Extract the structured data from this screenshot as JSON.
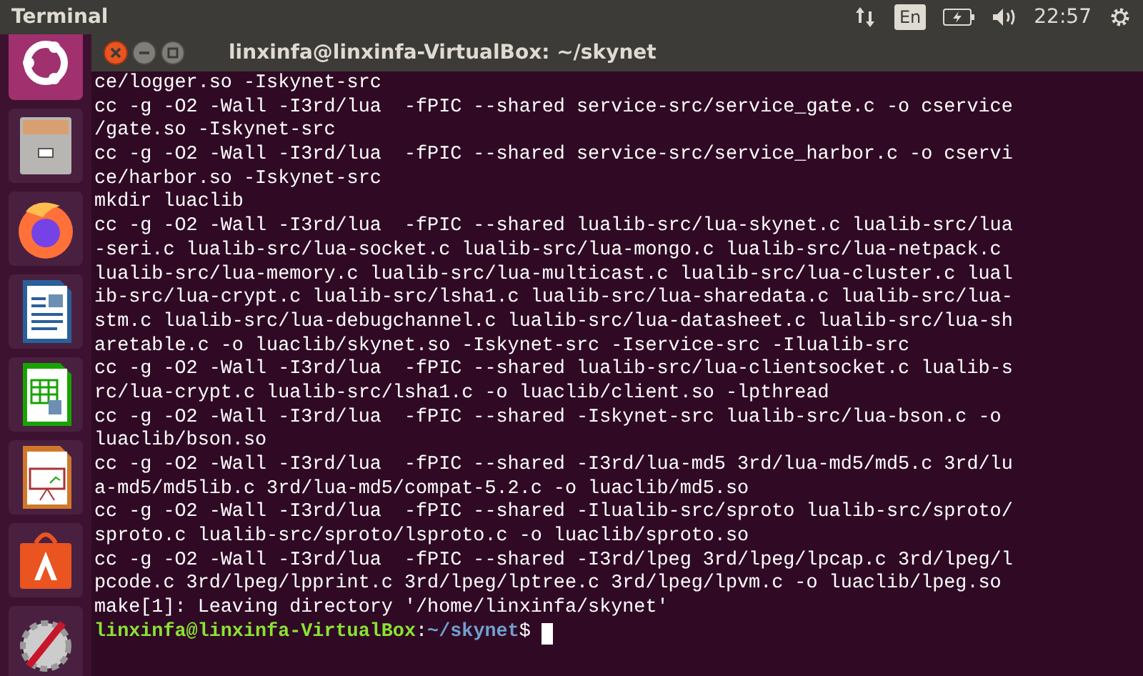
{
  "top_panel": {
    "app_title": "Terminal",
    "keyboard_layout": "En",
    "clock": "22:57"
  },
  "terminal": {
    "title": "linxinfa@linxinfa-VirtualBox: ~/skynet",
    "lines": [
      "ce/logger.so -Iskynet-src",
      "cc -g -O2 -Wall -I3rd/lua  -fPIC --shared service-src/service_gate.c -o cservice",
      "/gate.so -Iskynet-src",
      "cc -g -O2 -Wall -I3rd/lua  -fPIC --shared service-src/service_harbor.c -o cservi",
      "ce/harbor.so -Iskynet-src",
      "mkdir luaclib",
      "cc -g -O2 -Wall -I3rd/lua  -fPIC --shared lualib-src/lua-skynet.c lualib-src/lua",
      "-seri.c lualib-src/lua-socket.c lualib-src/lua-mongo.c lualib-src/lua-netpack.c",
      "lualib-src/lua-memory.c lualib-src/lua-multicast.c lualib-src/lua-cluster.c lual",
      "ib-src/lua-crypt.c lualib-src/lsha1.c lualib-src/lua-sharedata.c lualib-src/lua-",
      "stm.c lualib-src/lua-debugchannel.c lualib-src/lua-datasheet.c lualib-src/lua-sh",
      "aretable.c -o luaclib/skynet.so -Iskynet-src -Iservice-src -Ilualib-src",
      "cc -g -O2 -Wall -I3rd/lua  -fPIC --shared lualib-src/lua-clientsocket.c lualib-s",
      "rc/lua-crypt.c lualib-src/lsha1.c -o luaclib/client.so -lpthread",
      "cc -g -O2 -Wall -I3rd/lua  -fPIC --shared -Iskynet-src lualib-src/lua-bson.c -o",
      "luaclib/bson.so",
      "cc -g -O2 -Wall -I3rd/lua  -fPIC --shared -I3rd/lua-md5 3rd/lua-md5/md5.c 3rd/lu",
      "a-md5/md5lib.c 3rd/lua-md5/compat-5.2.c -o luaclib/md5.so",
      "cc -g -O2 -Wall -I3rd/lua  -fPIC --shared -Ilualib-src/sproto lualib-src/sproto/",
      "sproto.c lualib-src/sproto/lsproto.c -o luaclib/sproto.so",
      "cc -g -O2 -Wall -I3rd/lua  -fPIC --shared -I3rd/lpeg 3rd/lpeg/lpcap.c 3rd/lpeg/l",
      "pcode.c 3rd/lpeg/lpprint.c 3rd/lpeg/lptree.c 3rd/lpeg/lpvm.c -o luaclib/lpeg.so",
      "make[1]: Leaving directory '/home/linxinfa/skynet'"
    ],
    "prompt": {
      "user_host": "linxinfa@linxinfa-VirtualBox",
      "separator": ":",
      "path": "~/skynet",
      "symbol": "$"
    }
  }
}
